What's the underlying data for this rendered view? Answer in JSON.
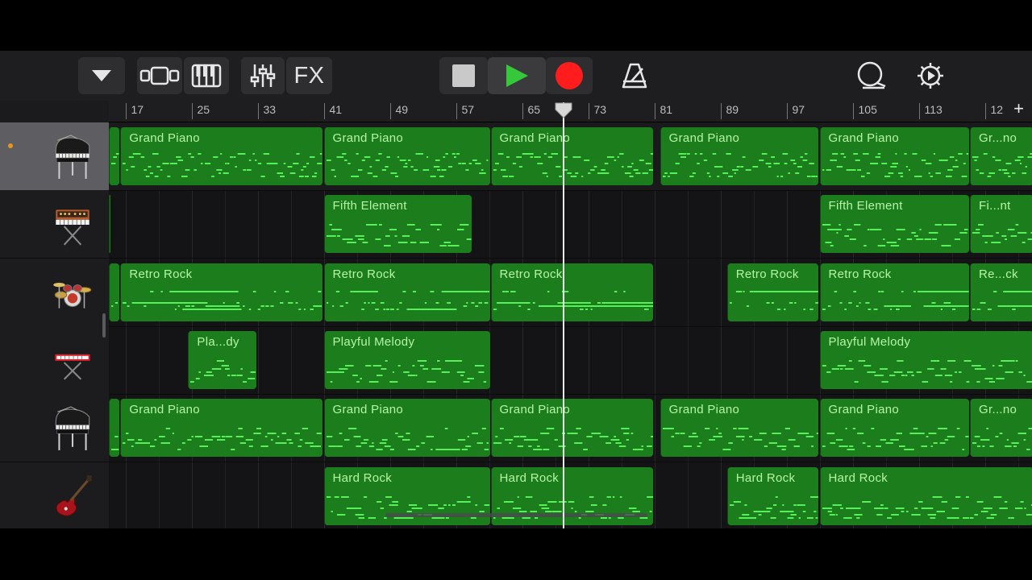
{
  "toolbar": {
    "buttons": [
      {
        "name": "browser-dropdown",
        "icon": "triangle-down-icon"
      },
      {
        "name": "tracks-view",
        "icon": "tracks-view-icon"
      },
      {
        "name": "instrument-view",
        "icon": "keyboard-icon"
      },
      {
        "name": "mixer",
        "icon": "sliders-icon"
      },
      {
        "name": "fx",
        "label": "FX"
      },
      {
        "name": "stop",
        "icon": "stop-icon"
      },
      {
        "name": "play",
        "icon": "play-icon"
      },
      {
        "name": "record",
        "icon": "record-icon"
      },
      {
        "name": "metronome",
        "icon": "metronome-icon"
      },
      {
        "name": "loops",
        "icon": "loop-browser-icon"
      },
      {
        "name": "settings",
        "icon": "gear-icon"
      }
    ],
    "fx_label": "FX",
    "colors": {
      "play": "#34c83a",
      "record": "#ff1c1c"
    }
  },
  "ruler": {
    "bars": [
      "17",
      "25",
      "33",
      "41",
      "49",
      "57",
      "65",
      "73",
      "81",
      "89",
      "97",
      "105",
      "113",
      "12"
    ],
    "add_symbol": "+"
  },
  "playhead_bar": 70,
  "tracks": [
    {
      "instrument": "grand-piano-icon",
      "selected": true,
      "recording": true,
      "regions": [
        {
          "label": "",
          "start": 15,
          "end": 16.4
        },
        {
          "label": "Grand Piano",
          "start": 16.4,
          "end": 41
        },
        {
          "label": "Grand Piano",
          "start": 41,
          "end": 61.2
        },
        {
          "label": "Grand Piano",
          "start": 61.2,
          "end": 81
        },
        {
          "label": "Grand Piano",
          "start": 81.7,
          "end": 101
        },
        {
          "label": "Grand Piano",
          "start": 101,
          "end": 119.2
        },
        {
          "label": "Gr...no",
          "start": 119.2,
          "end": 127
        }
      ]
    },
    {
      "instrument": "synthesizer-icon",
      "selected": false,
      "regions": [
        {
          "label": "",
          "start": 15,
          "end": 15.3
        },
        {
          "label": "Fifth Element",
          "start": 41,
          "end": 59
        },
        {
          "label": "Fifth Element",
          "start": 101,
          "end": 119.2
        },
        {
          "label": "Fi...nt",
          "start": 119.2,
          "end": 127
        }
      ]
    },
    {
      "instrument": "drum-kit-icon",
      "selected": false,
      "regions": [
        {
          "label": "",
          "start": 15,
          "end": 16.4
        },
        {
          "label": "Retro Rock",
          "start": 16.4,
          "end": 41
        },
        {
          "label": "Retro Rock",
          "start": 41,
          "end": 61.2
        },
        {
          "label": "Retro Rock",
          "start": 61.2,
          "end": 81
        },
        {
          "label": "Retro Rock",
          "start": 89.8,
          "end": 101
        },
        {
          "label": "Retro Rock",
          "start": 101,
          "end": 119.2
        },
        {
          "label": "Re...ck",
          "start": 119.2,
          "end": 127
        }
      ]
    },
    {
      "instrument": "keyboard-instrument-icon",
      "selected": false,
      "regions": [
        {
          "label": "Pla...dy",
          "start": 24.6,
          "end": 33
        },
        {
          "label": "Playful Melody",
          "start": 41,
          "end": 61.2
        },
        {
          "label": "Playful Melody",
          "start": 101,
          "end": 127
        }
      ]
    },
    {
      "instrument": "grand-piano-icon",
      "selected": false,
      "regions": [
        {
          "label": "",
          "start": 15,
          "end": 16.4
        },
        {
          "label": "Grand Piano",
          "start": 16.4,
          "end": 41
        },
        {
          "label": "Grand Piano",
          "start": 41,
          "end": 61.2
        },
        {
          "label": "Grand Piano",
          "start": 61.2,
          "end": 81
        },
        {
          "label": "Grand Piano",
          "start": 81.7,
          "end": 101
        },
        {
          "label": "Grand Piano",
          "start": 101,
          "end": 119.2
        },
        {
          "label": "Gr...no",
          "start": 119.2,
          "end": 127
        }
      ]
    },
    {
      "instrument": "electric-guitar-icon",
      "selected": false,
      "regions": [
        {
          "label": "Hard Rock",
          "start": 41,
          "end": 61.2
        },
        {
          "label": "Hard Rock",
          "start": 61.2,
          "end": 81
        },
        {
          "label": "Hard Rock",
          "start": 89.8,
          "end": 101
        },
        {
          "label": "Hard Rock",
          "start": 101,
          "end": 127
        }
      ]
    }
  ],
  "colors": {
    "region": "#1c7d1c",
    "note": "#57f05a",
    "region_label": "#b6f5a6",
    "track_selected": "#5e5e62"
  }
}
